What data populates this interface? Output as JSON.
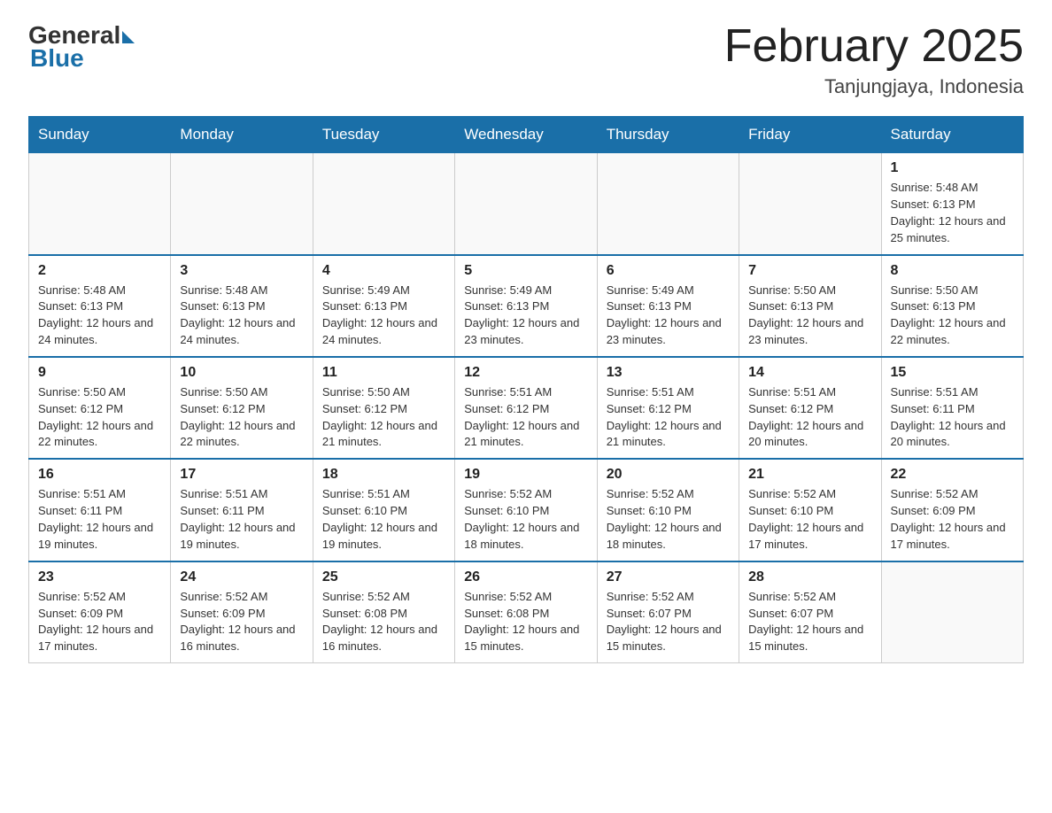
{
  "header": {
    "logo_general": "General",
    "logo_blue": "Blue",
    "month_title": "February 2025",
    "location": "Tanjungjaya, Indonesia"
  },
  "weekdays": [
    "Sunday",
    "Monday",
    "Tuesday",
    "Wednesday",
    "Thursday",
    "Friday",
    "Saturday"
  ],
  "weeks": [
    [
      {
        "day": "",
        "sunrise": "",
        "sunset": "",
        "daylight": ""
      },
      {
        "day": "",
        "sunrise": "",
        "sunset": "",
        "daylight": ""
      },
      {
        "day": "",
        "sunrise": "",
        "sunset": "",
        "daylight": ""
      },
      {
        "day": "",
        "sunrise": "",
        "sunset": "",
        "daylight": ""
      },
      {
        "day": "",
        "sunrise": "",
        "sunset": "",
        "daylight": ""
      },
      {
        "day": "",
        "sunrise": "",
        "sunset": "",
        "daylight": ""
      },
      {
        "day": "1",
        "sunrise": "Sunrise: 5:48 AM",
        "sunset": "Sunset: 6:13 PM",
        "daylight": "Daylight: 12 hours and 25 minutes."
      }
    ],
    [
      {
        "day": "2",
        "sunrise": "Sunrise: 5:48 AM",
        "sunset": "Sunset: 6:13 PM",
        "daylight": "Daylight: 12 hours and 24 minutes."
      },
      {
        "day": "3",
        "sunrise": "Sunrise: 5:48 AM",
        "sunset": "Sunset: 6:13 PM",
        "daylight": "Daylight: 12 hours and 24 minutes."
      },
      {
        "day": "4",
        "sunrise": "Sunrise: 5:49 AM",
        "sunset": "Sunset: 6:13 PM",
        "daylight": "Daylight: 12 hours and 24 minutes."
      },
      {
        "day": "5",
        "sunrise": "Sunrise: 5:49 AM",
        "sunset": "Sunset: 6:13 PM",
        "daylight": "Daylight: 12 hours and 23 minutes."
      },
      {
        "day": "6",
        "sunrise": "Sunrise: 5:49 AM",
        "sunset": "Sunset: 6:13 PM",
        "daylight": "Daylight: 12 hours and 23 minutes."
      },
      {
        "day": "7",
        "sunrise": "Sunrise: 5:50 AM",
        "sunset": "Sunset: 6:13 PM",
        "daylight": "Daylight: 12 hours and 23 minutes."
      },
      {
        "day": "8",
        "sunrise": "Sunrise: 5:50 AM",
        "sunset": "Sunset: 6:13 PM",
        "daylight": "Daylight: 12 hours and 22 minutes."
      }
    ],
    [
      {
        "day": "9",
        "sunrise": "Sunrise: 5:50 AM",
        "sunset": "Sunset: 6:12 PM",
        "daylight": "Daylight: 12 hours and 22 minutes."
      },
      {
        "day": "10",
        "sunrise": "Sunrise: 5:50 AM",
        "sunset": "Sunset: 6:12 PM",
        "daylight": "Daylight: 12 hours and 22 minutes."
      },
      {
        "day": "11",
        "sunrise": "Sunrise: 5:50 AM",
        "sunset": "Sunset: 6:12 PM",
        "daylight": "Daylight: 12 hours and 21 minutes."
      },
      {
        "day": "12",
        "sunrise": "Sunrise: 5:51 AM",
        "sunset": "Sunset: 6:12 PM",
        "daylight": "Daylight: 12 hours and 21 minutes."
      },
      {
        "day": "13",
        "sunrise": "Sunrise: 5:51 AM",
        "sunset": "Sunset: 6:12 PM",
        "daylight": "Daylight: 12 hours and 21 minutes."
      },
      {
        "day": "14",
        "sunrise": "Sunrise: 5:51 AM",
        "sunset": "Sunset: 6:12 PM",
        "daylight": "Daylight: 12 hours and 20 minutes."
      },
      {
        "day": "15",
        "sunrise": "Sunrise: 5:51 AM",
        "sunset": "Sunset: 6:11 PM",
        "daylight": "Daylight: 12 hours and 20 minutes."
      }
    ],
    [
      {
        "day": "16",
        "sunrise": "Sunrise: 5:51 AM",
        "sunset": "Sunset: 6:11 PM",
        "daylight": "Daylight: 12 hours and 19 minutes."
      },
      {
        "day": "17",
        "sunrise": "Sunrise: 5:51 AM",
        "sunset": "Sunset: 6:11 PM",
        "daylight": "Daylight: 12 hours and 19 minutes."
      },
      {
        "day": "18",
        "sunrise": "Sunrise: 5:51 AM",
        "sunset": "Sunset: 6:10 PM",
        "daylight": "Daylight: 12 hours and 19 minutes."
      },
      {
        "day": "19",
        "sunrise": "Sunrise: 5:52 AM",
        "sunset": "Sunset: 6:10 PM",
        "daylight": "Daylight: 12 hours and 18 minutes."
      },
      {
        "day": "20",
        "sunrise": "Sunrise: 5:52 AM",
        "sunset": "Sunset: 6:10 PM",
        "daylight": "Daylight: 12 hours and 18 minutes."
      },
      {
        "day": "21",
        "sunrise": "Sunrise: 5:52 AM",
        "sunset": "Sunset: 6:10 PM",
        "daylight": "Daylight: 12 hours and 17 minutes."
      },
      {
        "day": "22",
        "sunrise": "Sunrise: 5:52 AM",
        "sunset": "Sunset: 6:09 PM",
        "daylight": "Daylight: 12 hours and 17 minutes."
      }
    ],
    [
      {
        "day": "23",
        "sunrise": "Sunrise: 5:52 AM",
        "sunset": "Sunset: 6:09 PM",
        "daylight": "Daylight: 12 hours and 17 minutes."
      },
      {
        "day": "24",
        "sunrise": "Sunrise: 5:52 AM",
        "sunset": "Sunset: 6:09 PM",
        "daylight": "Daylight: 12 hours and 16 minutes."
      },
      {
        "day": "25",
        "sunrise": "Sunrise: 5:52 AM",
        "sunset": "Sunset: 6:08 PM",
        "daylight": "Daylight: 12 hours and 16 minutes."
      },
      {
        "day": "26",
        "sunrise": "Sunrise: 5:52 AM",
        "sunset": "Sunset: 6:08 PM",
        "daylight": "Daylight: 12 hours and 15 minutes."
      },
      {
        "day": "27",
        "sunrise": "Sunrise: 5:52 AM",
        "sunset": "Sunset: 6:07 PM",
        "daylight": "Daylight: 12 hours and 15 minutes."
      },
      {
        "day": "28",
        "sunrise": "Sunrise: 5:52 AM",
        "sunset": "Sunset: 6:07 PM",
        "daylight": "Daylight: 12 hours and 15 minutes."
      },
      {
        "day": "",
        "sunrise": "",
        "sunset": "",
        "daylight": ""
      }
    ]
  ]
}
